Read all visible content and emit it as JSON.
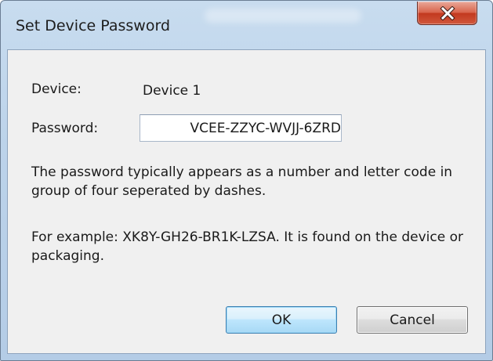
{
  "window": {
    "title": "Set Device Password",
    "close_icon": "close-icon"
  },
  "form": {
    "device_label": "Device:",
    "device_value": "Device 1",
    "password_label": "Password:",
    "password_value": "VCEE-ZZYC-WVJJ-6ZRD"
  },
  "help": {
    "line1": "The password typically appears as a number and letter code in group of four seperated by dashes.",
    "line2": "For example: XK8Y-GH26-BR1K-LZSA. It is found on the device or packaging."
  },
  "buttons": {
    "ok_label": "OK",
    "cancel_label": "Cancel"
  }
}
